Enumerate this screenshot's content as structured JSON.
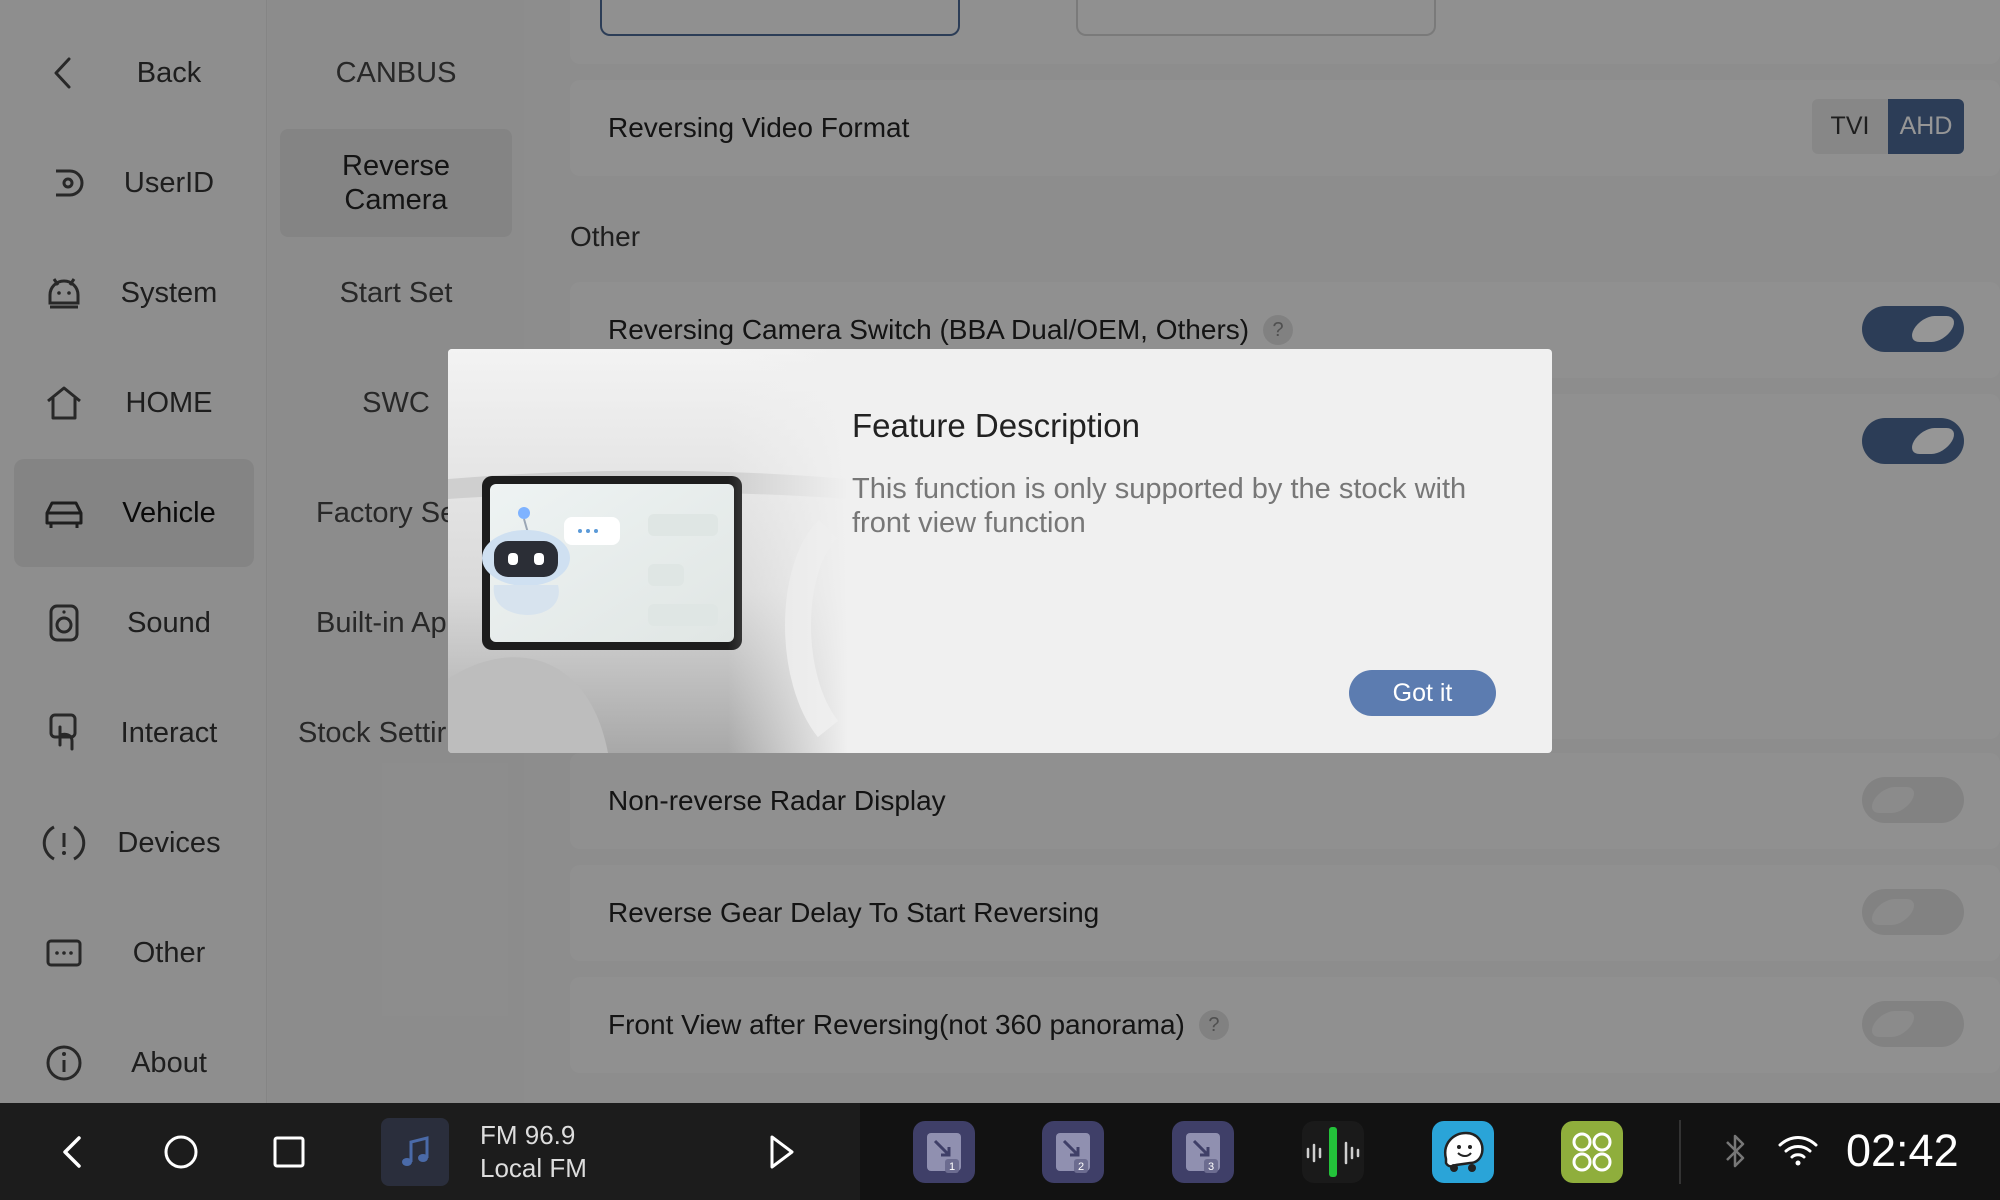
{
  "primary_nav": {
    "back": "Back",
    "items": [
      {
        "label": "UserID",
        "icon": "user-id-icon"
      },
      {
        "label": "System",
        "icon": "android-icon"
      },
      {
        "label": "HOME",
        "icon": "home-icon"
      },
      {
        "label": "Vehicle",
        "icon": "car-icon",
        "active": true
      },
      {
        "label": "Sound",
        "icon": "speaker-icon"
      },
      {
        "label": "Interact",
        "icon": "touch-icon"
      },
      {
        "label": "Devices",
        "icon": "alert-icon"
      },
      {
        "label": "Other",
        "icon": "more-icon"
      },
      {
        "label": "About",
        "icon": "info-icon"
      }
    ]
  },
  "secondary_nav": {
    "items": [
      {
        "label": "CANBUS"
      },
      {
        "label": "Reverse Camera",
        "active": true
      },
      {
        "label": "Start Set"
      },
      {
        "label": "SWC"
      },
      {
        "label": "Factory Se"
      },
      {
        "label": "Built-in Ap"
      },
      {
        "label": "Stock Settir"
      }
    ]
  },
  "settings": {
    "video_format": {
      "label": "Reversing Video Format",
      "options": [
        "TVI",
        "AHD"
      ],
      "selected": "AHD"
    },
    "section_other": "Other",
    "camera_switch": {
      "label": "Reversing Camera Switch (BBA Dual/OEM, Others)",
      "help": "?",
      "on": true
    },
    "hidden_toggle": {
      "on": true
    },
    "radar_display": {
      "label": "Non-reverse Radar Display",
      "on": false
    },
    "gear_delay": {
      "label": "Reverse Gear Delay To Start Reversing",
      "on": false
    },
    "front_view": {
      "label": "Front View after Reversing(not 360 panorama)",
      "help": "?",
      "on": false
    }
  },
  "modal": {
    "title": "Feature Description",
    "description": "This function is only supported by the stock with front view function",
    "button": "Got it"
  },
  "bottom_bar": {
    "media_title": "FM 96.9",
    "media_subtitle": "Local FM",
    "app_badges": [
      "1",
      "2",
      "3"
    ],
    "clock": "02:42"
  },
  "colors": {
    "accent": "#4c6994",
    "button": "#5c7cb0",
    "bar": "#121212"
  }
}
